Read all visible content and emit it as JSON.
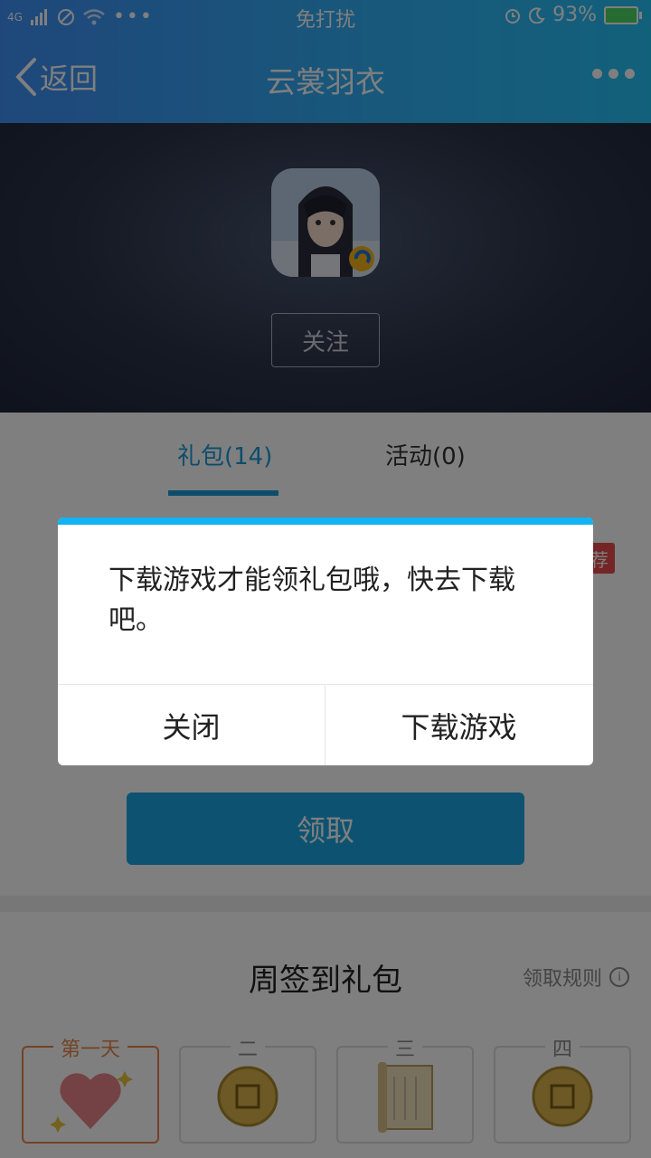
{
  "status_bar": {
    "network": "4G",
    "center_text": "免打扰",
    "battery": "93%"
  },
  "nav": {
    "back_label": "返回",
    "title": "云裳羽衣"
  },
  "hero": {
    "follow_label": "关注"
  },
  "tabs": {
    "gift_label": "礼包(14)",
    "activity_label": "活动(0)"
  },
  "content": {
    "recommend_badge": "荐",
    "claim_label": "领取"
  },
  "weekly": {
    "title": "周签到礼包",
    "rules_label": "领取规则",
    "days": [
      "第一天",
      "二",
      "三",
      "四"
    ]
  },
  "dialog": {
    "message": "下载游戏才能领礼包哦，快去下载吧。",
    "close_label": "关闭",
    "download_label": "下载游戏"
  },
  "colors": {
    "accent": "#1a9bd8",
    "dialog_top": "#12b3f3",
    "badge": "#e84b4b",
    "active_day": "#e8854a"
  }
}
